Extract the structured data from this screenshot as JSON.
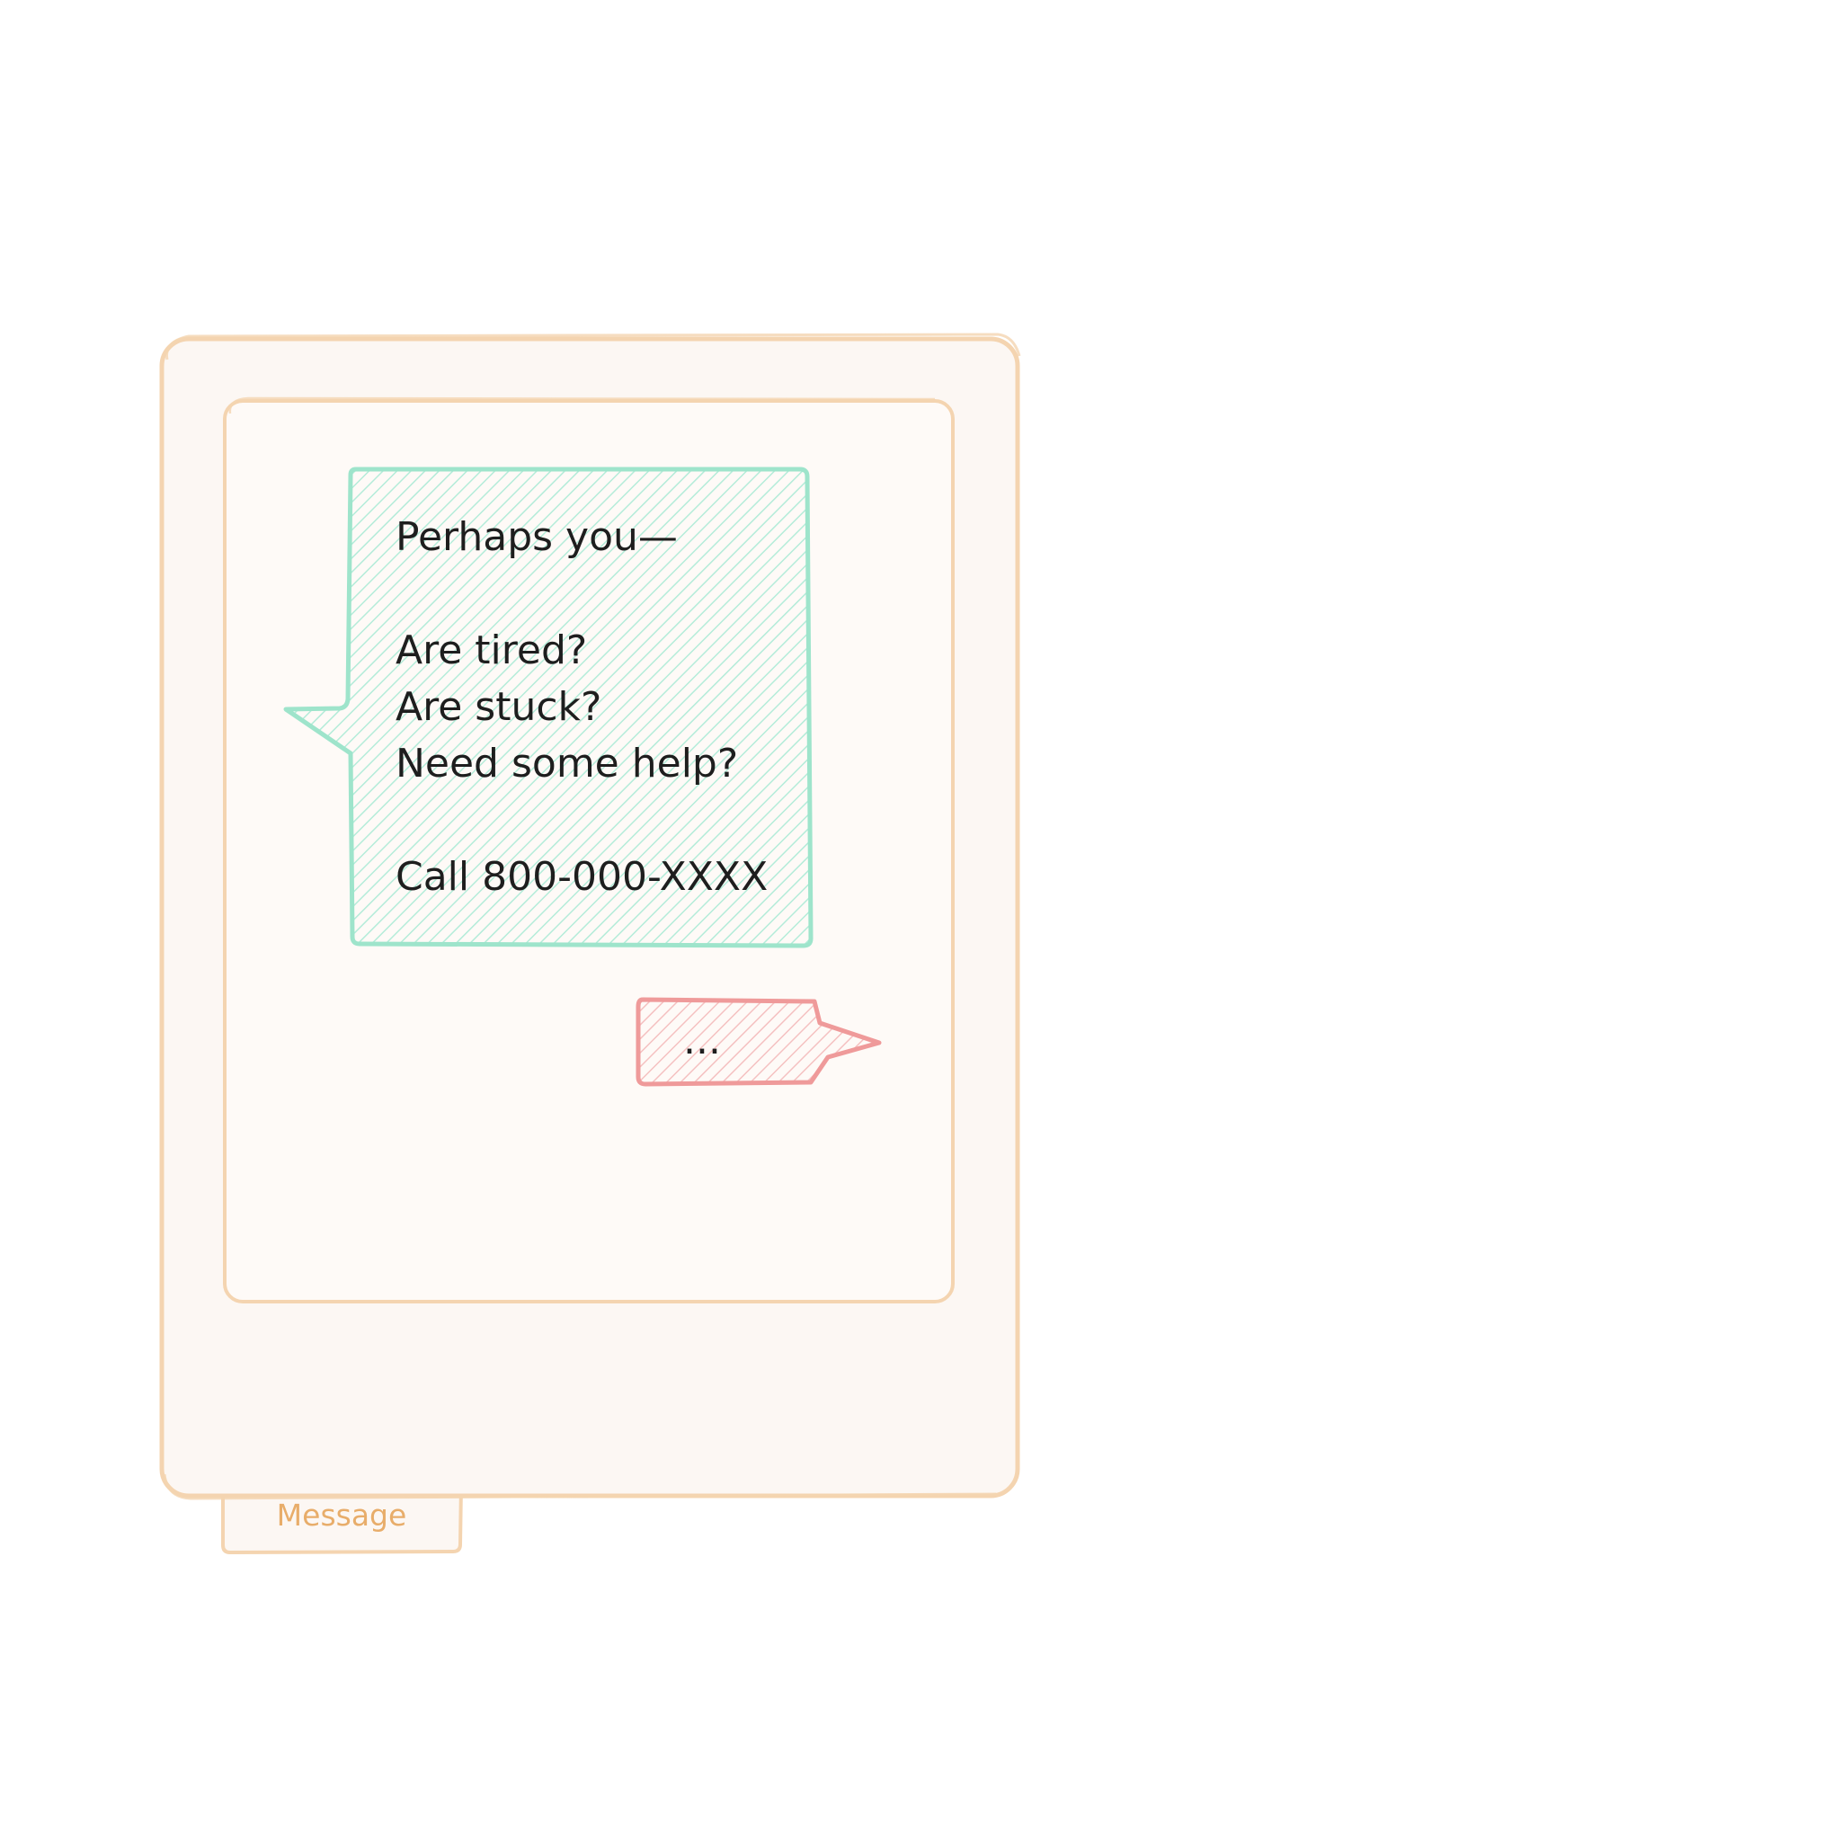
{
  "colors": {
    "frame_stroke": "#f4d4b0",
    "frame_fill": "#fcf7f3",
    "screen_fill": "#fefaf7",
    "incoming_stroke": "#9ee4cb",
    "incoming_hatch": "#b4ecd9",
    "outgoing_stroke": "#ef9a9a",
    "outgoing_hatch": "#f5c1c1",
    "text": "#1e1e1e",
    "tab_text": "#e8ad6a"
  },
  "phone": {
    "tab_label": "Message"
  },
  "messages": [
    {
      "direction": "incoming",
      "lines": [
        "Perhaps you—",
        "",
        "Are tired?",
        "Are stuck?",
        "Need some help?",
        "",
        "Call 800-000-XXXX"
      ]
    },
    {
      "direction": "outgoing",
      "lines": [
        "..."
      ]
    }
  ]
}
